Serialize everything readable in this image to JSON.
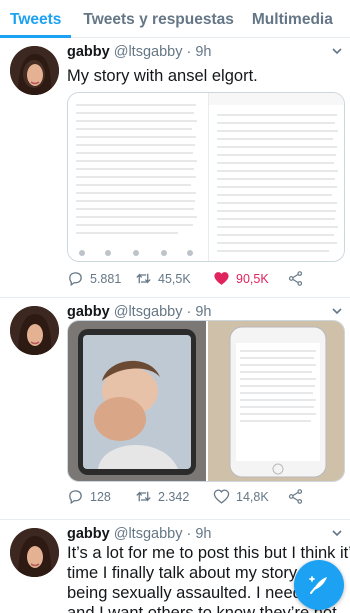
{
  "tabs": [
    {
      "label": "Tweets",
      "active": true
    },
    {
      "label": "Tweets y respuestas",
      "active": false
    },
    {
      "label": "Multimedia",
      "active": false
    }
  ],
  "colors": {
    "accent": "#1da1f2",
    "like": "#e0245e",
    "secondary": "#657786"
  },
  "tweets": [
    {
      "name": "gabby",
      "handle": "@ltsgabby",
      "time": "9h",
      "text": "My story with ansel elgort.",
      "replies": "5.881",
      "retweets": "45,5K",
      "likes": "90,5K",
      "liked": true
    },
    {
      "name": "gabby",
      "handle": "@ltsgabby",
      "time": "9h",
      "text": "",
      "replies": "128",
      "retweets": "2.342",
      "likes": "14,8K",
      "liked": false
    },
    {
      "name": "gabby",
      "handle": "@ltsgabby",
      "time": "9h",
      "text_lines": [
        "It’s a lot for me to post this but I think it’s",
        "time I finally talk about my story of",
        "being sexually assaulted. I need to",
        "and I want others to know they’re not"
      ]
    }
  ],
  "icons": {
    "reply": "reply-icon",
    "retweet": "retweet-icon",
    "like": "heart-icon",
    "share": "share-icon",
    "compose": "compose-tweet-icon",
    "menu": "chevron-down-icon"
  }
}
